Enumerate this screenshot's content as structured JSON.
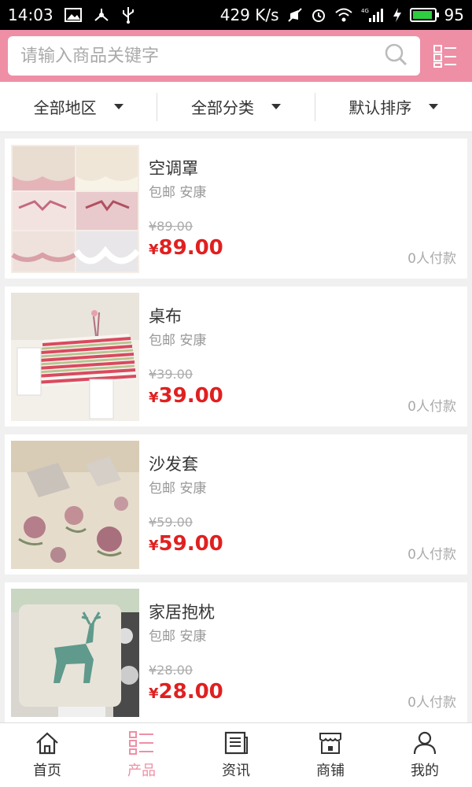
{
  "status_bar": {
    "time": "14:03",
    "speed": "429 K/s",
    "battery": "95",
    "battery_level": 0.95,
    "signal_label": "4G",
    "icons": [
      "image-icon",
      "usb-tether-icon",
      "usb-icon",
      "mute-icon",
      "alarm-icon",
      "wifi-icon",
      "signal-icon",
      "charging-icon",
      "battery-icon"
    ]
  },
  "header": {
    "search_placeholder": "请输入商品关键字",
    "accent_color": "#ee8fa6"
  },
  "filters": [
    {
      "label": "全部地区"
    },
    {
      "label": "全部分类"
    },
    {
      "label": "默认排序"
    }
  ],
  "products": [
    {
      "name": "空调罩",
      "tag": "包邮 安康",
      "original_price": "¥89.00",
      "currency": "¥",
      "price": "89.00",
      "sold": "0人付款"
    },
    {
      "name": "桌布",
      "tag": "包邮 安康",
      "original_price": "¥39.00",
      "currency": "¥",
      "price": "39.00",
      "sold": "0人付款"
    },
    {
      "name": "沙发套",
      "tag": "包邮 安康",
      "original_price": "¥59.00",
      "currency": "¥",
      "price": "59.00",
      "sold": "0人付款"
    },
    {
      "name": "家居抱枕",
      "tag": "包邮 安康",
      "original_price": "¥28.00",
      "currency": "¥",
      "price": "28.00",
      "sold": "0人付款"
    }
  ],
  "bottom_nav": [
    {
      "label": "首页",
      "icon": "home-icon"
    },
    {
      "label": "产品",
      "icon": "list-icon",
      "active": true
    },
    {
      "label": "资讯",
      "icon": "news-icon"
    },
    {
      "label": "商铺",
      "icon": "shop-icon"
    },
    {
      "label": "我的",
      "icon": "user-icon"
    }
  ],
  "colors": {
    "price": "#e02020",
    "active_tab": "#ee8fa6"
  }
}
